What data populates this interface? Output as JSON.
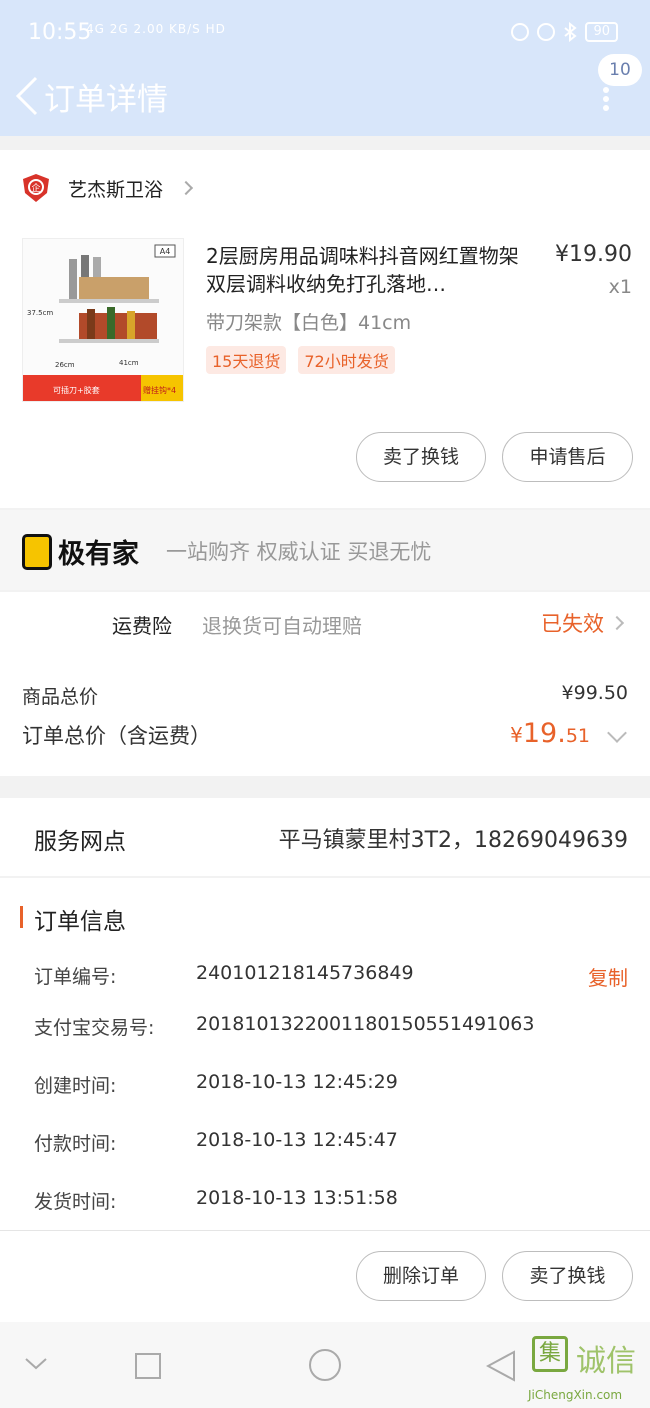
{
  "status_bar": {
    "time": "10:55",
    "network": "4G 2G 2.00 KB/S HD",
    "battery": "90"
  },
  "nav": {
    "title": "订单详情",
    "badge": "10"
  },
  "shop": {
    "name": "艺杰斯卫浴",
    "logo_text": "企"
  },
  "product": {
    "title": "2层厨房用品调味料抖音网红置物架双层调料收纳免打孔落地…",
    "price": "¥19.90",
    "qty": "x1",
    "spec": "带刀架款【白色】41cm",
    "tags": [
      "15天退货",
      "72小时发货"
    ],
    "image_labels": {
      "size_tag": "A4",
      "height": "37.5cm",
      "depth": "26cm",
      "width": "41cm",
      "caption_left": "可插刀+胶套",
      "caption_right": "赠挂钩*4"
    }
  },
  "product_actions": {
    "sell_label": "卖了换钱",
    "aftersale_label": "申请售后"
  },
  "jiyoujia": {
    "name": "极有家",
    "slogan": "一站购齐 权威认证 买退无忧"
  },
  "insurance": {
    "label": "运费险",
    "desc": "退换货可自动理赔",
    "status": "已失效"
  },
  "pricing": {
    "goods_label": "商品总价",
    "goods_value": "¥99.50",
    "total_label": "订单总价（含运费）",
    "total_currency": "¥",
    "total_int": "19.",
    "total_dec": "51"
  },
  "service": {
    "label": "服务网点",
    "value": "平马镇蒙里村3T2，18269049639"
  },
  "order_info": {
    "title": "订单信息",
    "copy_label": "复制",
    "rows": [
      {
        "label": "订单编号:",
        "value": "240101218145736849"
      },
      {
        "label": "支付宝交易号:",
        "value": "2018101322001180150551491063"
      },
      {
        "label": "创建时间:",
        "value": "2018-10-13 12:45:29"
      },
      {
        "label": "付款时间:",
        "value": "2018-10-13 12:45:47"
      },
      {
        "label": "发货时间:",
        "value": "2018-10-13 13:51:58"
      }
    ]
  },
  "order_actions": {
    "delete_label": "删除订单",
    "sell_label": "卖了换钱"
  },
  "watermark": {
    "logo_char": "集",
    "chars": "诚信",
    "text": "JiChengXin.com"
  },
  "colors": {
    "header_bg": "#d8e6fa",
    "accent": "#e8622a",
    "tag_bg": "#fde9e3"
  }
}
